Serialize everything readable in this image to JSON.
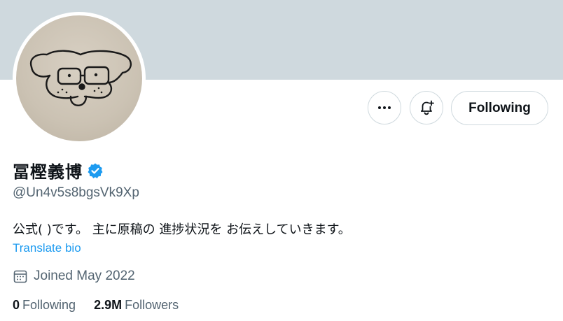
{
  "profile": {
    "display_name": "冨樫義博",
    "handle": "@Un4v5s8bgsVk9Xp",
    "bio": "公式( )です。 主に原稿の 進捗状況を お伝えしていきます。",
    "translate_label": "Translate bio",
    "joined": "Joined May 2022",
    "following_count": "0",
    "following_label": "Following",
    "followers_count": "2.9M",
    "followers_label": "Followers"
  },
  "actions": {
    "following_button": "Following",
    "more_icon": "more-horizontal-icon",
    "notify_icon": "bell-plus-icon"
  },
  "colors": {
    "banner": "#cfd9de",
    "link": "#1d9bf0",
    "verified": "#1d9bf0",
    "secondary_text": "#536471"
  }
}
